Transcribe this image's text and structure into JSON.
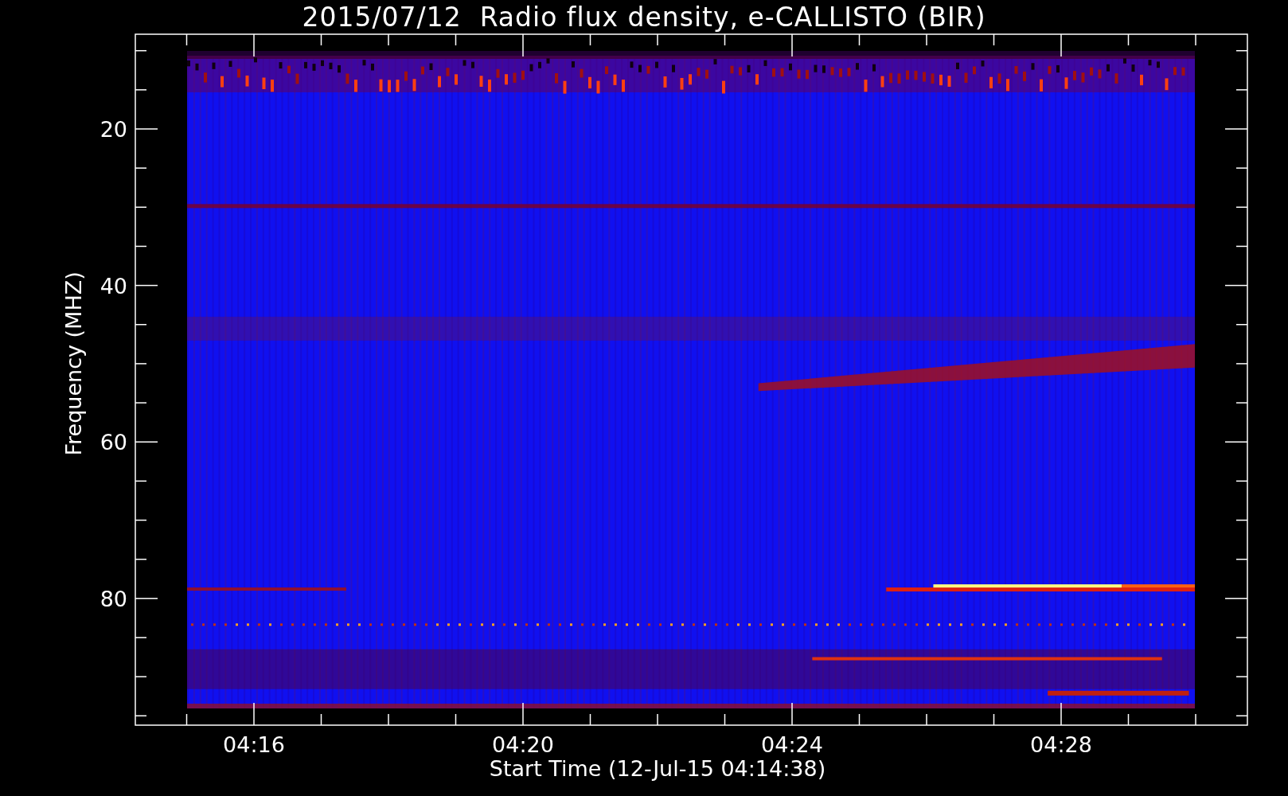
{
  "title": "2015/07/12  Radio flux density, e-CALLISTO (BIR)",
  "y_axis": {
    "label": "Frequency (MHZ)",
    "ticks": [
      "20",
      "40",
      "60",
      "80"
    ]
  },
  "x_axis": {
    "label": "Start Time (12-Jul-15 04:14:38)",
    "ticks": [
      "04:16",
      "04:20",
      "04:24",
      "04:28"
    ]
  }
}
